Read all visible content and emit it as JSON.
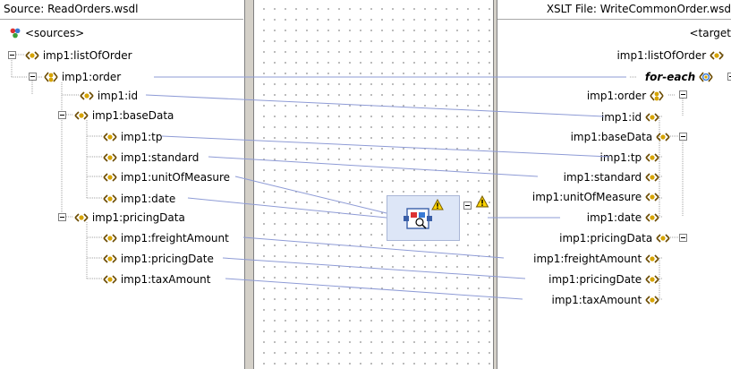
{
  "source_panel": {
    "header": "Source: ReadOrders.wsdl",
    "root": "<sources>",
    "items": [
      {
        "label": "imp1:listOfOrder"
      },
      {
        "label": "imp1:order"
      },
      {
        "label": "imp1:id"
      },
      {
        "label": "imp1:baseData"
      },
      {
        "label": "imp1:tp"
      },
      {
        "label": "imp1:standard"
      },
      {
        "label": "imp1:unitOfMeasure"
      },
      {
        "label": "imp1:date"
      },
      {
        "label": "imp1:pricingData"
      },
      {
        "label": "imp1:freightAmount"
      },
      {
        "label": "imp1:pricingDate"
      },
      {
        "label": "imp1:taxAmount"
      }
    ]
  },
  "target_panel": {
    "header": "XSLT File: WriteCommonOrder.wsd",
    "root": "<target",
    "items": [
      {
        "label": "imp1:listOfOrder"
      },
      {
        "label": "for-each"
      },
      {
        "label": "imp1:order"
      },
      {
        "label": "imp1:id"
      },
      {
        "label": "imp1:baseData"
      },
      {
        "label": "imp1:tp"
      },
      {
        "label": "imp1:standard"
      },
      {
        "label": "imp1:unitOfMeasure"
      },
      {
        "label": "imp1:date"
      },
      {
        "label": "imp1:pricingData"
      },
      {
        "label": "imp1:freightAmount"
      },
      {
        "label": "imp1:pricingDate"
      },
      {
        "label": "imp1:taxAmount"
      }
    ]
  },
  "mapping_canvas": {
    "function_icon": "function-component-icon",
    "warning_icon": "warning-triangle-icon"
  },
  "colors": {
    "element_icon": "#d7a400",
    "element_bracket": "#6b4a00",
    "mapping_line": "#8e9bd6",
    "function_box": "#dde6f7",
    "warning": "#ffd400"
  }
}
